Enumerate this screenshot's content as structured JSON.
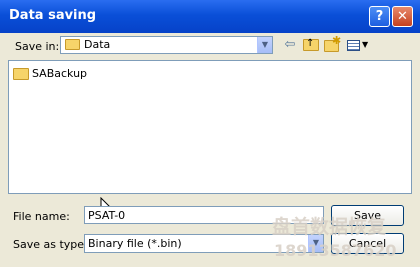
{
  "window": {
    "title": "Data saving"
  },
  "titlebar": {
    "help_label": "?",
    "close_label": "✕"
  },
  "toolbar": {
    "save_in_label": "Save in:",
    "save_in_value": "Data",
    "back_icon": "arrow-left-icon",
    "up_icon": "folder-up-icon",
    "new_folder_icon": "new-folder-icon",
    "view_icon": "view-menu-icon"
  },
  "file_list": [
    {
      "name": "SABackup",
      "icon": "folder-icon"
    }
  ],
  "form": {
    "file_name_label": "File name:",
    "file_name_value": "PSAT-0",
    "save_as_type_label": "Save as type:",
    "save_as_type_value": "Binary file (*.bin)",
    "save_label": "Save",
    "cancel_label": "Cancel"
  },
  "watermark": {
    "line1": "盘首数据恢复",
    "line2": "18913587620"
  }
}
